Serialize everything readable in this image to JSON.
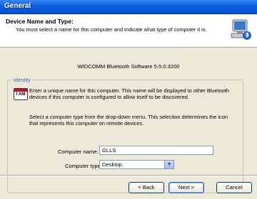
{
  "window": {
    "title": "General"
  },
  "header": {
    "title": "Device Name and Type:",
    "subtitle": "You must select a name for this computer and indicate what type of computer it is.",
    "icon": "computer-bluetooth-icon"
  },
  "software": "WIDCOMM Bluetooth Software 5.5.0.3200",
  "identity": {
    "legend": "Identity",
    "badge_text": "I AM",
    "para1": "Enter a unique name for this computer.  This name will be displayed to other Bluetooth devices if this computer is configured to allow itself to be discovered.",
    "para2": "Select a computer type from the drop-down menu.  This selection determines the icon that represents this computer on remote devices.",
    "name_label": "Computer name:",
    "name_value": "GLLS",
    "type_label": "Computer type:",
    "type_value": "Desktop"
  },
  "buttons": {
    "back": "< Back",
    "next": "Next >",
    "cancel": "Cancel"
  }
}
